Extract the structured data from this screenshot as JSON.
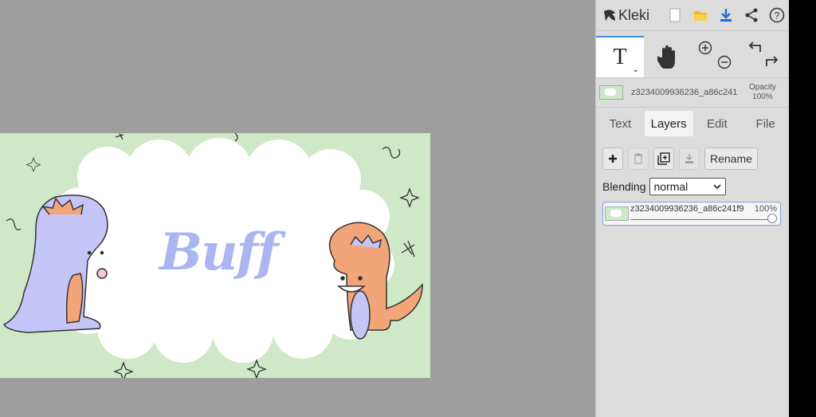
{
  "app": {
    "name": "Kleki",
    "colors": {
      "canvas_bg": "#9e9e9e",
      "panel_bg": "#dcdcdc",
      "accent": "#3c8bd9",
      "image_bg": "#cfe8c8"
    }
  },
  "toolbar": {
    "icons": [
      "kleki-logo-icon",
      "new-image-icon",
      "open-folder-icon",
      "download-icon",
      "share-icon",
      "help-icon"
    ]
  },
  "tools": {
    "text_tool": "T",
    "icons": [
      "text-tool-icon",
      "hand-tool-icon",
      "zoom-in-icon",
      "zoom-out-icon",
      "undo-icon",
      "redo-icon"
    ]
  },
  "layer_info": {
    "name": "z3234009936236_a86c241",
    "opacity_label": "Opacity",
    "opacity_value": "100%"
  },
  "tabs": [
    {
      "label": "Text",
      "active": false
    },
    {
      "label": "Layers",
      "active": true
    },
    {
      "label": "Edit",
      "active": false
    },
    {
      "label": "File",
      "active": false
    }
  ],
  "layers_panel": {
    "buttons": [
      "add-layer",
      "delete-layer",
      "duplicate-layer",
      "merge-layer"
    ],
    "rename_label": "Rename",
    "blending_label": "Blending",
    "blending_value": "normal",
    "layer": {
      "name": "z3234009936236_a86c241f9",
      "opacity": "100%",
      "opacity_fraction": 1.0
    }
  },
  "canvas_image": {
    "text": "Buff"
  }
}
